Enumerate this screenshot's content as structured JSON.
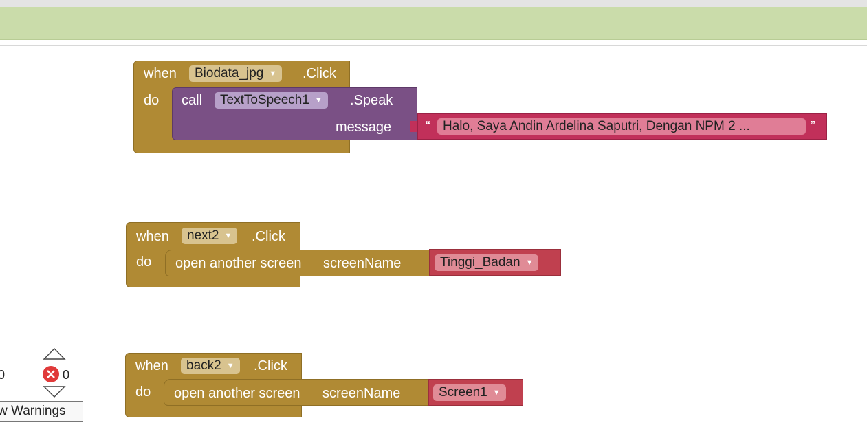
{
  "blocks": [
    {
      "event": {
        "when_label": "when",
        "component": "Biodata_jpg",
        "event_name": ".Click",
        "do_label": "do"
      },
      "call": {
        "call_label": "call",
        "component": "TextToSpeech1",
        "method": ".Speak",
        "param_label": "message"
      },
      "string": {
        "open_quote": "“",
        "value": "Halo, Saya Andin Ardelina Saputri, Dengan NPM 2 ...",
        "close_quote": "”"
      }
    },
    {
      "event": {
        "when_label": "when",
        "component": "next2",
        "event_name": ".Click",
        "do_label": "do"
      },
      "action": {
        "label": "open another screen",
        "param_label": "screenName"
      },
      "screen": {
        "value": "Tinggi_Badan"
      }
    },
    {
      "event": {
        "when_label": "when",
        "component": "back2",
        "event_name": ".Click",
        "do_label": "do"
      },
      "action": {
        "label": "open another screen",
        "param_label": "screenName"
      },
      "screen": {
        "value": "Screen1"
      }
    }
  ],
  "warnings": {
    "warning_count_partial": "0",
    "error_count": "0",
    "toggle_button": "w Warnings"
  },
  "colors": {
    "event_block": "#b08a34",
    "call_block": "#7a5085",
    "string_block": "#c1305a",
    "screen_block": "#c0404f",
    "header_bar": "#cadcaa"
  }
}
